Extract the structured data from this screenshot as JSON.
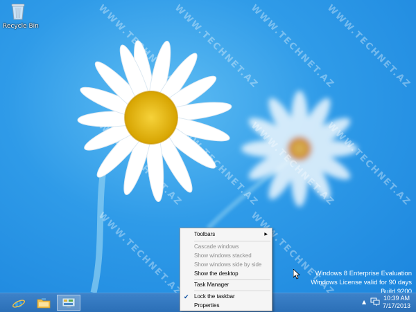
{
  "desktop": {
    "recycle_bin_label": "Recycle Bin",
    "watermark_text": "WWW.TECHNET.AZ",
    "system_info": {
      "line1": "Windows 8 Enterprise Evaluation",
      "line2": "Windows License valid for 90 days",
      "line3": "Build 9200"
    }
  },
  "taskbar": {
    "pinned": [
      {
        "name": "internet-explorer",
        "icon": "ie-icon"
      },
      {
        "name": "file-explorer",
        "icon": "folder-icon"
      },
      {
        "name": "control-panel",
        "icon": "control-panel-icon"
      }
    ],
    "clock": {
      "time": "10:39 AM",
      "date": "7/17/2013"
    }
  },
  "context_menu": {
    "items": [
      {
        "label": "Toolbars",
        "submenu": true,
        "enabled": true
      },
      {
        "label": "Cascade windows",
        "enabled": false
      },
      {
        "label": "Show windows stacked",
        "enabled": false
      },
      {
        "label": "Show windows side by side",
        "enabled": false
      },
      {
        "label": "Show the desktop",
        "enabled": true
      },
      {
        "label": "Task Manager",
        "enabled": true
      },
      {
        "label": "Lock the taskbar",
        "enabled": true,
        "checked": true
      },
      {
        "label": "Properties",
        "enabled": true
      }
    ]
  },
  "colors": {
    "taskbar": "#2f74bc",
    "desktop_bg": "#2f9be8",
    "menu_bg": "#f5f5f5"
  }
}
